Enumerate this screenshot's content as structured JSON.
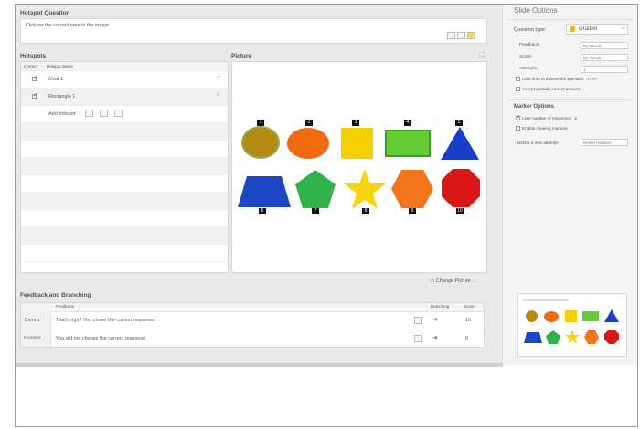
{
  "hotspot_question": {
    "header": "Hotspot Question",
    "text": "Click on the correct area in the image."
  },
  "hotspots": {
    "header": "Hotspots",
    "col_correct": "Correct",
    "col_name": "Hotspot Name",
    "rows": [
      {
        "name": "Oval 1",
        "checked": true
      },
      {
        "name": "Rectangle 1",
        "checked": true
      }
    ],
    "add_hotspot": "Add hotspot"
  },
  "picture": {
    "header": "Picture",
    "change_picture": "Change Picture",
    "numbers": [
      "1",
      "2",
      "3",
      "4",
      "5",
      "6",
      "7",
      "8",
      "9",
      "10"
    ]
  },
  "feedback": {
    "header": "Feedback and Branching",
    "col_feedback": "Feedback",
    "col_branching": "Branching",
    "col_score": "Score",
    "rows": [
      {
        "type": "Correct",
        "text": "That's right! You chose the correct response.",
        "score": "10"
      },
      {
        "type": "Incorrect",
        "text": "You did not choose the correct response.",
        "score": "0"
      }
    ]
  },
  "slide_options": {
    "header": "Slide Options",
    "question_type_label": "Question type:",
    "question_type_value": "Graded",
    "feedback_label": "Feedback:",
    "feedback_value": "By Result",
    "score_label": "Score:",
    "score_value": "By Result",
    "attempts_label": "Attempts:",
    "attempts_value": "1",
    "limit_time": "Limit time to answer the question",
    "limit_time_value": "01:00",
    "accept_partial": "Accept partially correct answers"
  },
  "marker_options": {
    "header": "Marker Options",
    "limit_responses": "Limit number of responses",
    "limit_responses_value": "2",
    "enable_clearing": "Enable clearing markers",
    "before_new_attempt": "Before a new attempt:",
    "before_new_attempt_value": "Delete markers"
  }
}
